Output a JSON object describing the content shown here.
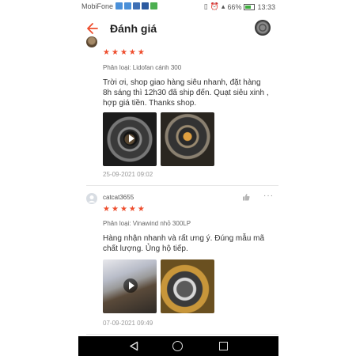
{
  "status_bar": {
    "carrier": "MobiFone",
    "battery_text": "66%",
    "battery_level": 0.66,
    "time": "13:33"
  },
  "app_bar": {
    "title": "Đánh giá",
    "back_icon": "arrow-left-icon",
    "accent": "#ee4d2d"
  },
  "reviews": [
    {
      "rating": 5,
      "stars": "★★★★★",
      "variant": "Phân loại: Lidofan cánh 300",
      "text": "Trời ơi, shop giao hàng siêu nhanh, đặt hàng 8h sáng thì 12h30 đã ship đến. Quạt siêu xinh , hợp giá tiền. Thanks shop.",
      "date": "25-09-2021 09:02"
    },
    {
      "name": "catcat3655",
      "rating": 5,
      "stars": "★★★★★",
      "variant": "Phân loại: Vinawind nhỏ 300LP",
      "text": "Hàng nhận nhanh và rất ưng ý. Đúng mẫu mã chất lượng. Ủng hộ tiếp.",
      "date": "07-09-2021 09:49"
    }
  ],
  "nav_bar": {
    "back_icon": "triangle-back-icon",
    "home_icon": "circle-home-icon",
    "recent_icon": "square-recent-icon"
  }
}
